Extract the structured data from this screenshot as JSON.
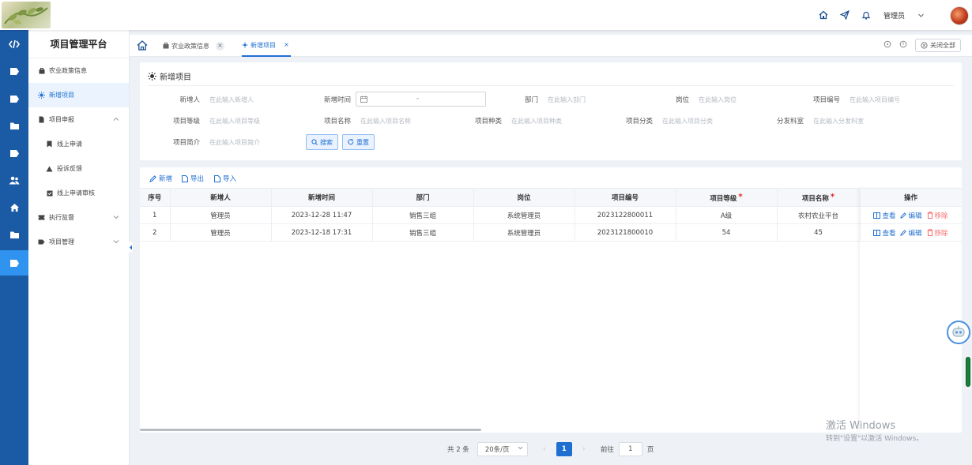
{
  "header": {
    "user": "管理员",
    "icons": [
      "home-icon",
      "send-icon",
      "bell-icon",
      "chevron-down-icon"
    ]
  },
  "sidebar": {
    "title": "项目管理平台",
    "items": [
      {
        "label": "农业政策信息",
        "icon": "briefcase-icon"
      },
      {
        "label": "新增项目",
        "icon": "sun-icon"
      },
      {
        "label": "项目申报",
        "icon": "document-icon"
      },
      {
        "label": "线上申请",
        "icon": "bookmark-icon"
      },
      {
        "label": "投诉反馈",
        "icon": "warning-icon"
      },
      {
        "label": "线上申请审核",
        "icon": "checkbox-icon"
      },
      {
        "label": "执行监督",
        "icon": "ticket-icon"
      },
      {
        "label": "项目管理",
        "icon": "tag-icon"
      }
    ]
  },
  "tabs": [
    {
      "label": "农业政策信息"
    },
    {
      "label": "新增项目"
    }
  ],
  "close_all": "关闭全部",
  "search": {
    "title": "新增项目",
    "fields": [
      {
        "label": "新增人",
        "placeholder": "在此输入新增人"
      },
      {
        "label": "新增时间",
        "placeholder": "-"
      },
      {
        "label": "部门",
        "placeholder": "在此输入部门"
      },
      {
        "label": "岗位",
        "placeholder": "在此输入岗位"
      },
      {
        "label": "项目编号",
        "placeholder": "在此输入项目编号"
      },
      {
        "label": "项目等级",
        "placeholder": "在此输入项目等级"
      },
      {
        "label": "项目名称",
        "placeholder": "在此输入项目名称"
      },
      {
        "label": "项目种类",
        "placeholder": "在此输入项目种类"
      },
      {
        "label": "项目分类",
        "placeholder": "在此输入项目分类"
      },
      {
        "label": "分发科室",
        "placeholder": "在此输入分发科室"
      },
      {
        "label": "项目简介",
        "placeholder": "在此输入项目简介"
      }
    ],
    "search_btn": "搜索",
    "reset_btn": "重置"
  },
  "toolbar": {
    "add": "新增",
    "export": "导出",
    "import": "导入"
  },
  "table": {
    "columns": [
      "序号",
      "新增人",
      "新增时间",
      "部门",
      "岗位",
      "项目编号",
      "项目等级",
      "项目名称",
      "操作"
    ],
    "rows": [
      [
        "1",
        "管理员",
        "2023-12-28 11:47",
        "销售三组",
        "系统管理员",
        "2023122800011",
        "A级",
        "农村农业平台"
      ],
      [
        "2",
        "管理员",
        "2023-12-18 17:31",
        "销售三组",
        "系统管理员",
        "2023121800010",
        "54",
        "45"
      ]
    ],
    "actions": {
      "view": "查看",
      "edit": "编辑",
      "remove": "移除"
    }
  },
  "pagination": {
    "total": "共 2 条",
    "page_size": "20条/页",
    "current": "1",
    "goto_label": "前往",
    "goto_value": "1",
    "page_unit": "页"
  },
  "watermark": {
    "line1": "激活 Windows",
    "line2": "转到\"设置\"以激活 Windows。"
  },
  "colors": {
    "primary": "#1f6fd1",
    "rail": "#1b5aa5",
    "rail_active": "#2f93ef",
    "danger": "#f56c6c"
  }
}
